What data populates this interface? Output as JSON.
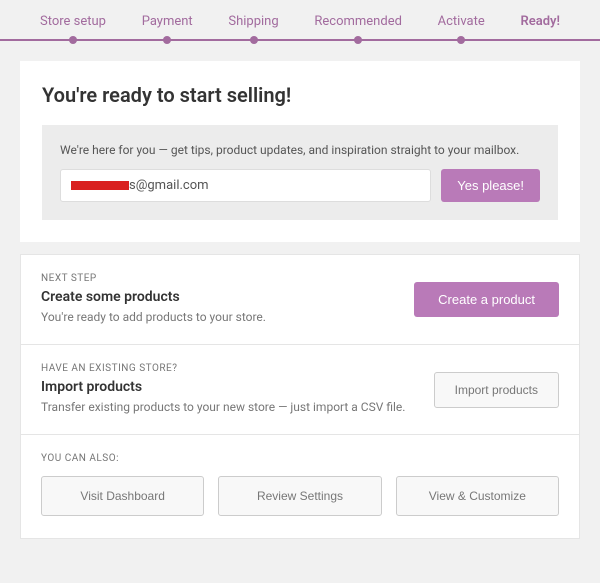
{
  "tabs": {
    "items": [
      {
        "label": "Store setup"
      },
      {
        "label": "Payment"
      },
      {
        "label": "Shipping"
      },
      {
        "label": "Recommended"
      },
      {
        "label": "Activate"
      },
      {
        "label": "Ready!"
      }
    ]
  },
  "heading": "You're ready to start selling!",
  "signup": {
    "text": "We're here for you — get tips, product updates, and inspiration straight to your mailbox.",
    "email_suffix": "s@gmail.com",
    "button": "Yes please!"
  },
  "next_step": {
    "overline": "NEXT STEP",
    "title": "Create some products",
    "desc": "You're ready to add products to your store.",
    "button": "Create a product"
  },
  "import": {
    "overline": "HAVE AN EXISTING STORE?",
    "title": "Import products",
    "desc": "Transfer existing products to your new store — just import a CSV file.",
    "button": "Import products"
  },
  "also": {
    "overline": "YOU CAN ALSO:",
    "buttons": [
      "Visit Dashboard",
      "Review Settings",
      "View & Customize"
    ]
  }
}
